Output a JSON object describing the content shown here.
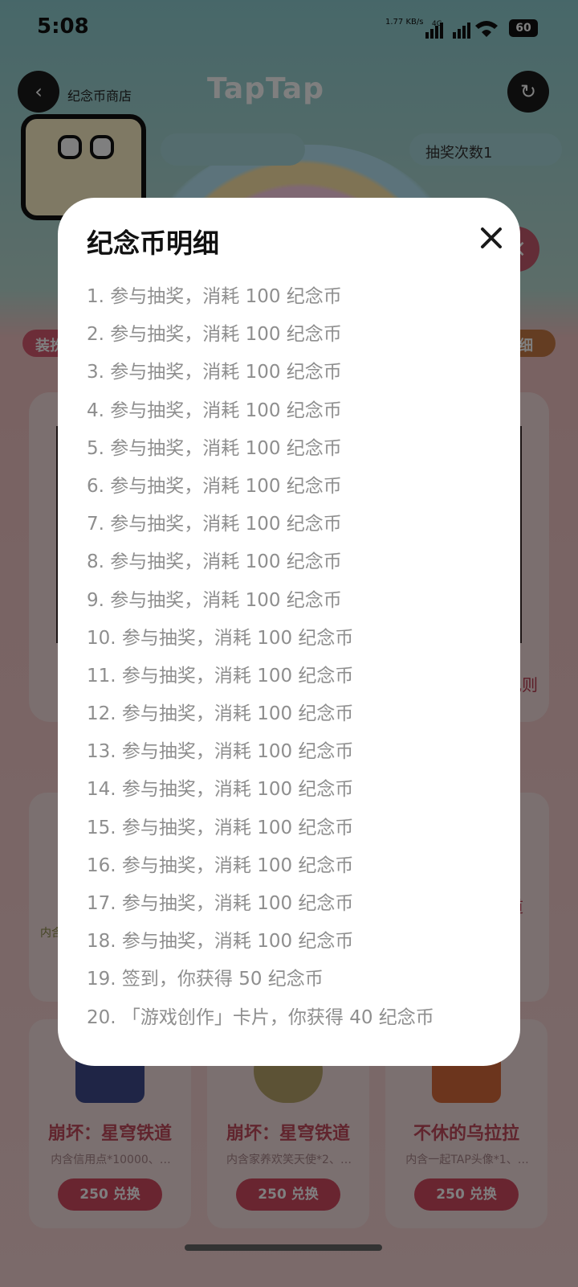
{
  "status_bar": {
    "time": "5:08",
    "network_speed": "1.77 KB/s",
    "network_type": "4G",
    "battery": "60"
  },
  "background": {
    "brand": "TapTap",
    "header_subtitle": "纪念币商店",
    "chip_right_label": "抽奖次数1",
    "pill_left": "装扮",
    "pill_right": "明细",
    "panel_link": "规则",
    "strip_note": "内含",
    "strip_link": "道",
    "shop_items": [
      {
        "title": "崩坏：星穹铁道",
        "desc": "内含信用点*10000、…",
        "button": "250 兑换",
        "color": "#3f4a8c"
      },
      {
        "title": "崩坏：星穹铁道",
        "desc": "内含家养欢笑天使*2、…",
        "button": "250 兑换",
        "color": "#b8a46a"
      },
      {
        "title": "不休的乌拉拉",
        "desc": "内含一起TAP头像*1、…",
        "button": "250 兑换",
        "color": "#d96b3b"
      }
    ]
  },
  "modal": {
    "title": "纪念币明细",
    "close_icon": "close-icon",
    "entries": [
      "1. 参与抽奖，消耗 100 纪念币",
      "2. 参与抽奖，消耗 100 纪念币",
      "3. 参与抽奖，消耗 100 纪念币",
      "4. 参与抽奖，消耗 100 纪念币",
      "5. 参与抽奖，消耗 100 纪念币",
      "6. 参与抽奖，消耗 100 纪念币",
      "7. 参与抽奖，消耗 100 纪念币",
      "8. 参与抽奖，消耗 100 纪念币",
      "9. 参与抽奖，消耗 100 纪念币",
      "10. 参与抽奖，消耗 100 纪念币",
      "11. 参与抽奖，消耗 100 纪念币",
      "12. 参与抽奖，消耗 100 纪念币",
      "13. 参与抽奖，消耗 100 纪念币",
      "14. 参与抽奖，消耗 100 纪念币",
      "15. 参与抽奖，消耗 100 纪念币",
      "16. 参与抽奖，消耗 100 纪念币",
      "17. 参与抽奖，消耗 100 纪念币",
      "18. 参与抽奖，消耗 100 纪念币",
      "19. 签到，你获得 50 纪念币",
      "20. 「游戏创作」卡片，你获得 40 纪念币"
    ]
  },
  "colors": {
    "overlay": "rgba(0,0,0,0.5)",
    "modal_bg": "#ffffff",
    "title_text": "#111111",
    "entry_text": "#8e8e8e",
    "accent": "#d24a61"
  }
}
